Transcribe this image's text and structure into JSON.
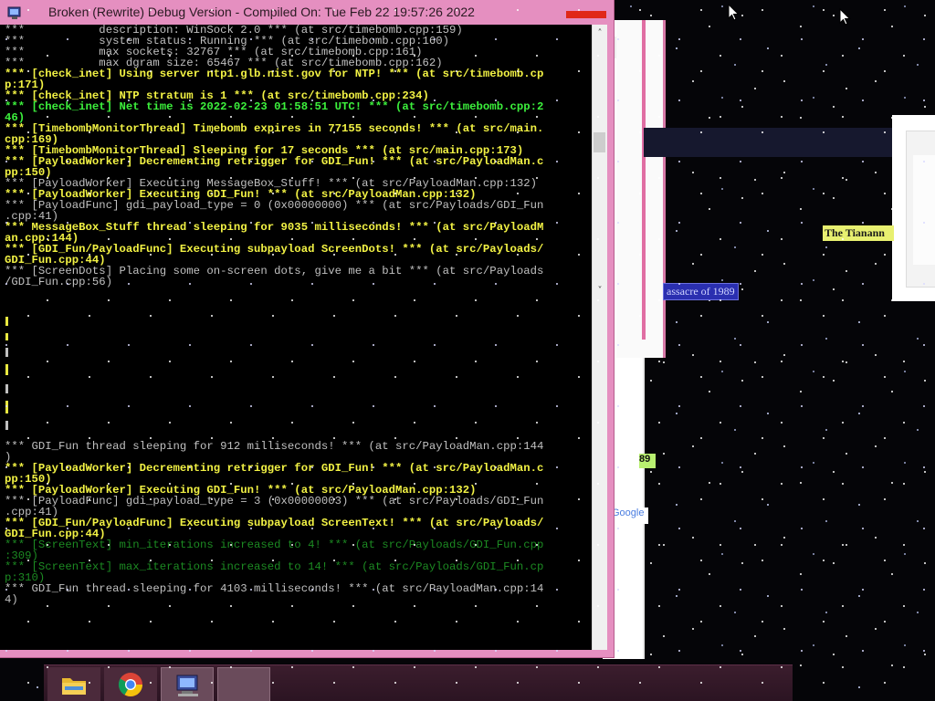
{
  "window": {
    "title": "Broken (Rewrite) Debug Version - Compiled On: Tue Feb 22 19:57:26 2022",
    "accent_color": "#e58fc0",
    "close_color": "#e02818"
  },
  "console": {
    "lines": [
      {
        "text": "***           description: WinSock 2.0 *** (at src/timebomb.cpp:159)",
        "color": "w"
      },
      {
        "text": "***           system status: Running *** (at src/timebomb.cpp:160)",
        "color": "w"
      },
      {
        "text": "***           max sockets: 32767 *** (at src/timebomb.cpp:161)",
        "color": "w"
      },
      {
        "text": "***           max dgram size: 65467 *** (at src/timebomb.cpp:162)",
        "color": "w"
      },
      {
        "text": "*** [check_inet] Using server ntp1.glb.nist.gov for NTP! *** (at src/timebomb.cp",
        "color": "y"
      },
      {
        "text": "p:171)",
        "color": "y"
      },
      {
        "text": "*** [check_inet] NTP stratum is 1 *** (at src/timebomb.cpp:234)",
        "color": "y"
      },
      {
        "text": "*** [check_inet] Net time is 2022-02-23 01:58:51 UTC! *** (at src/timebomb.cpp:2",
        "color": "g"
      },
      {
        "text": "46)",
        "color": "g"
      },
      {
        "text": "*** [TimebombMonitorThread] Timebomb expires in 77155 seconds! *** (at src/main.",
        "color": "y"
      },
      {
        "text": "cpp:169)",
        "color": "y"
      },
      {
        "text": "*** [TimebombMonitorThread] Sleeping for 17 seconds *** (at src/main.cpp:173)",
        "color": "y"
      },
      {
        "text": "*** [PayloadWorker] Decrementing retrigger for GDI_Fun! *** (at src/PayloadMan.c",
        "color": "y"
      },
      {
        "text": "pp:150)",
        "color": "y"
      },
      {
        "text": "*** [PayloadWorker] Executing MessageBox_Stuff! *** (at src/PayloadMan.cpp:132)",
        "color": "w"
      },
      {
        "text": "*** [PayloadWorker] Executing GDI_Fun! *** (at src/PayloadMan.cpp:132)",
        "color": "y"
      },
      {
        "text": "*** [PayloadFunc] gdi_payload_type = 0 (0x00000000) *** (at src/Payloads/GDI_Fun",
        "color": "w"
      },
      {
        "text": ".cpp:41)",
        "color": "w"
      },
      {
        "text": "*** MessageBox_Stuff thread sleeping for 9035 milliseconds! *** (at src/PayloadM",
        "color": "y"
      },
      {
        "text": "an.cpp:144)",
        "color": "y"
      },
      {
        "text": "*** [GDI_Fun/PayloadFunc] Executing subpayload ScreenDots! *** (at src/Payloads/",
        "color": "y"
      },
      {
        "text": "GDI_Fun.cpp:44)",
        "color": "y"
      },
      {
        "text": "*** [ScreenDots] Placing some on-screen dots, give me a bit *** (at src/Payloads",
        "color": "w"
      },
      {
        "text": "/GDI_Fun.cpp:56)",
        "color": "w"
      },
      {
        "text": "",
        "color": "w"
      },
      {
        "text": "",
        "color": "w"
      },
      {
        "text": "",
        "color": "w"
      },
      {
        "text": "",
        "color": "w"
      },
      {
        "text": "",
        "color": "w"
      },
      {
        "text": "",
        "color": "w"
      },
      {
        "text": "",
        "color": "w"
      },
      {
        "text": "",
        "color": "w"
      },
      {
        "text": "",
        "color": "w"
      },
      {
        "text": "",
        "color": "w"
      },
      {
        "text": "",
        "color": "w"
      },
      {
        "text": "",
        "color": "w"
      },
      {
        "text": "",
        "color": "w"
      },
      {
        "text": "",
        "color": "w"
      },
      {
        "text": "*** GDI_Fun thread sleeping for 912 milliseconds! *** (at src/PayloadMan.cpp:144",
        "color": "w"
      },
      {
        "text": ")",
        "color": "w"
      },
      {
        "text": "*** [PayloadWorker] Decrementing retrigger for GDI_Fun! *** (at src/PayloadMan.c",
        "color": "y"
      },
      {
        "text": "pp:150)",
        "color": "y"
      },
      {
        "text": "*** [PayloadWorker] Executing GDI_Fun! *** (at src/PayloadMan.cpp:132)",
        "color": "y"
      },
      {
        "text": "*** [PayloadFunc] gdi_payload_type = 3 (0x00000003) *** (at src/Payloads/GDI_Fun",
        "color": "w"
      },
      {
        "text": ".cpp:41)",
        "color": "w"
      },
      {
        "text": "*** [GDI_Fun/PayloadFunc] Executing subpayload ScreenText! *** (at src/Payloads/",
        "color": "y"
      },
      {
        "text": "GDI_Fun.cpp:44)",
        "color": "y"
      },
      {
        "text": "*** [ScreenText] min_iterations increased to 4! *** (at src/Payloads/GDI_Fun.cpp",
        "color": "dg"
      },
      {
        "text": ":309)",
        "color": "dg"
      },
      {
        "text": "*** [ScreenText] max_iterations increased to 14! *** (at src/Payloads/GDI_Fun.cp",
        "color": "dg"
      },
      {
        "text": "p:310)",
        "color": "dg"
      },
      {
        "text": "*** GDI_Fun thread sleeping for 4103 milliseconds! *** (at src/PayloadMan.cpp:14",
        "color": "w"
      },
      {
        "text": "4)",
        "color": "w"
      }
    ]
  },
  "background": {
    "google_fragment": "Google",
    "green_fragment": "89",
    "tiananmen_a": "The Tianann",
    "tiananmen_b": "assacre of 1989"
  },
  "taskbar": {
    "items": [
      {
        "name": "file-explorer",
        "icon": "folder-icon"
      },
      {
        "name": "chrome",
        "icon": "chrome-icon"
      },
      {
        "name": "console-app",
        "icon": "console-app-icon",
        "active": true
      },
      {
        "name": "empty-slot",
        "icon": ""
      }
    ]
  }
}
